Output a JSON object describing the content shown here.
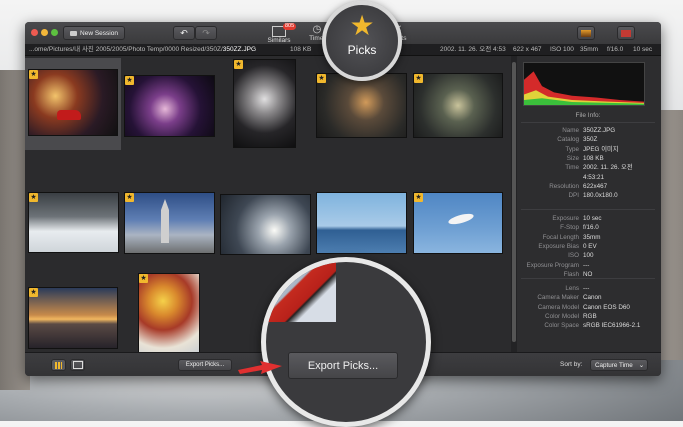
{
  "toolbar": {
    "new_session": "New Session",
    "similars_label": "Similars",
    "similars_badge": "805",
    "timeline_label": "Timel",
    "picks_label": "Picks",
    "rejects_label": "ejects"
  },
  "pathbar": {
    "path": "...ome/Pictures/내 사진 2005/2005/Photo Temp/0000 Resized/350Z/",
    "filename": "350ZZ.JPG",
    "filesize": "108 KB",
    "datetime": "2002. 11. 26. 오전 4:53",
    "dimensions": "622 x 467",
    "iso": "ISO 100",
    "focal": "35mm",
    "fstop": "f/16.0",
    "exposure": "10 sec"
  },
  "sidebar": {
    "file_info_title": "File Info:",
    "file_rows": [
      {
        "k": "Name",
        "v": "350ZZ.JPG"
      },
      {
        "k": "Catalog",
        "v": "350Z"
      },
      {
        "k": "Type",
        "v": "JPEG 이미지"
      },
      {
        "k": "Size",
        "v": "108 KB"
      },
      {
        "k": "Time",
        "v": "2002. 11. 26. 오전"
      },
      {
        "k": "",
        "v": "4:53:21"
      },
      {
        "k": "Resolution",
        "v": "622x467"
      },
      {
        "k": "DPI",
        "v": "180.0x180.0"
      }
    ],
    "exif_rows": [
      {
        "k": "Exposure",
        "v": "10 sec"
      },
      {
        "k": "F-Stop",
        "v": "f/16.0"
      },
      {
        "k": "Focal Length",
        "v": "35mm"
      },
      {
        "k": "Exposure Bias",
        "v": "0 EV"
      },
      {
        "k": "ISO",
        "v": "100"
      },
      {
        "k": "Exposure Program",
        "v": "---"
      },
      {
        "k": "Flash",
        "v": "NO"
      }
    ],
    "camera_rows": [
      {
        "k": "Lens",
        "v": "---"
      },
      {
        "k": "Camera Maker",
        "v": "Canon"
      },
      {
        "k": "Camera Model",
        "v": "Canon EOS D60"
      },
      {
        "k": "Color Model",
        "v": "RGB"
      },
      {
        "k": "Color Space",
        "v": "sRGB IEC61966-2.1"
      }
    ]
  },
  "bottom": {
    "export_small": "Export Picks...",
    "export_large": "Export Picks...",
    "sort_label": "Sort by:",
    "sort_value": "Capture Time"
  },
  "icons": {
    "star": "★",
    "close": "✕",
    "clock": "◷"
  },
  "colors": {
    "star": "#f1b82d",
    "badge": "#e03a2f",
    "callout_arrow": "#e03030"
  }
}
